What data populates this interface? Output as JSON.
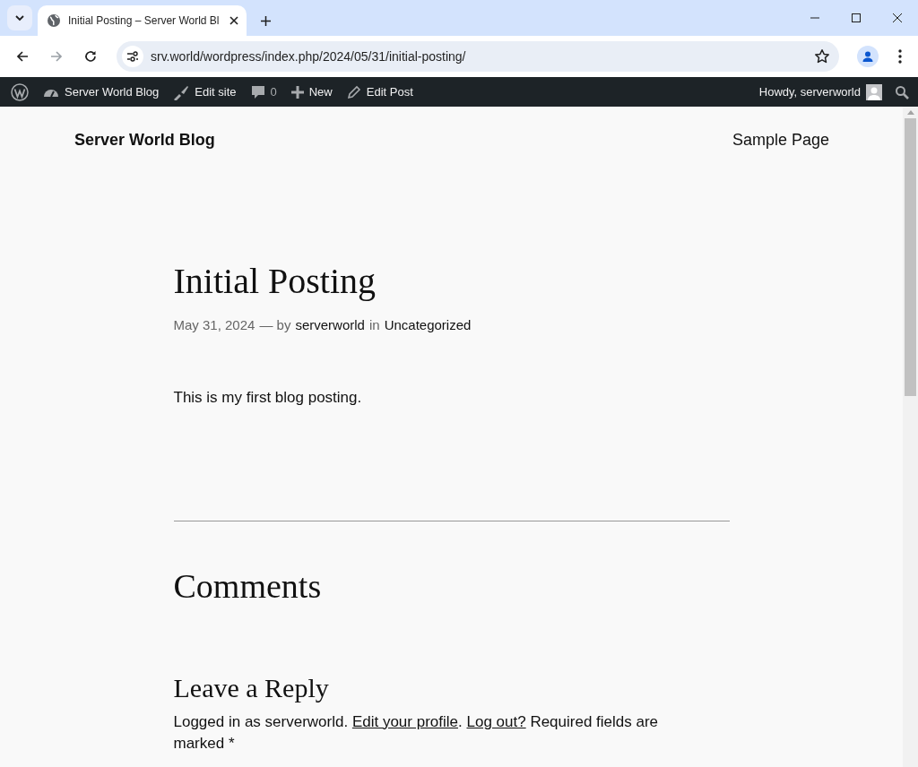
{
  "browser": {
    "tab": {
      "title": "Initial Posting – Server World Bl",
      "selected": true
    },
    "url": "srv.world/wordpress/index.php/2024/05/31/initial-posting/"
  },
  "admin_bar": {
    "items": [
      {
        "kind": "logo"
      },
      {
        "kind": "site",
        "label": "Server World Blog"
      },
      {
        "kind": "edit-site",
        "label": "Edit site"
      },
      {
        "kind": "comments",
        "label": "0"
      },
      {
        "kind": "new",
        "label": "New"
      },
      {
        "kind": "edit-post",
        "label": "Edit Post"
      }
    ],
    "greeting": "Howdy, serverworld"
  },
  "site": {
    "title": "Server World Blog",
    "nav": [
      "Sample Page"
    ]
  },
  "post": {
    "title": "Initial Posting",
    "meta": [
      {
        "kind": "muted",
        "text": "May 31, 2024"
      },
      {
        "kind": "muted",
        "text": "— by"
      },
      {
        "kind": "link",
        "text": "serverworld"
      },
      {
        "kind": "muted",
        "text": "in"
      },
      {
        "kind": "link",
        "text": "Uncategorized"
      }
    ],
    "body": "This is my first blog posting."
  },
  "comments": {
    "title": "Comments",
    "reply_title": "Leave a Reply",
    "logged_in": [
      {
        "kind": "text",
        "text": "Logged in as serverworld. "
      },
      {
        "kind": "link",
        "text": "Edit your profile"
      },
      {
        "kind": "text",
        "text": ". "
      },
      {
        "kind": "link",
        "text": "Log out?"
      },
      {
        "kind": "text",
        "text": " Required fields are marked *"
      }
    ]
  }
}
